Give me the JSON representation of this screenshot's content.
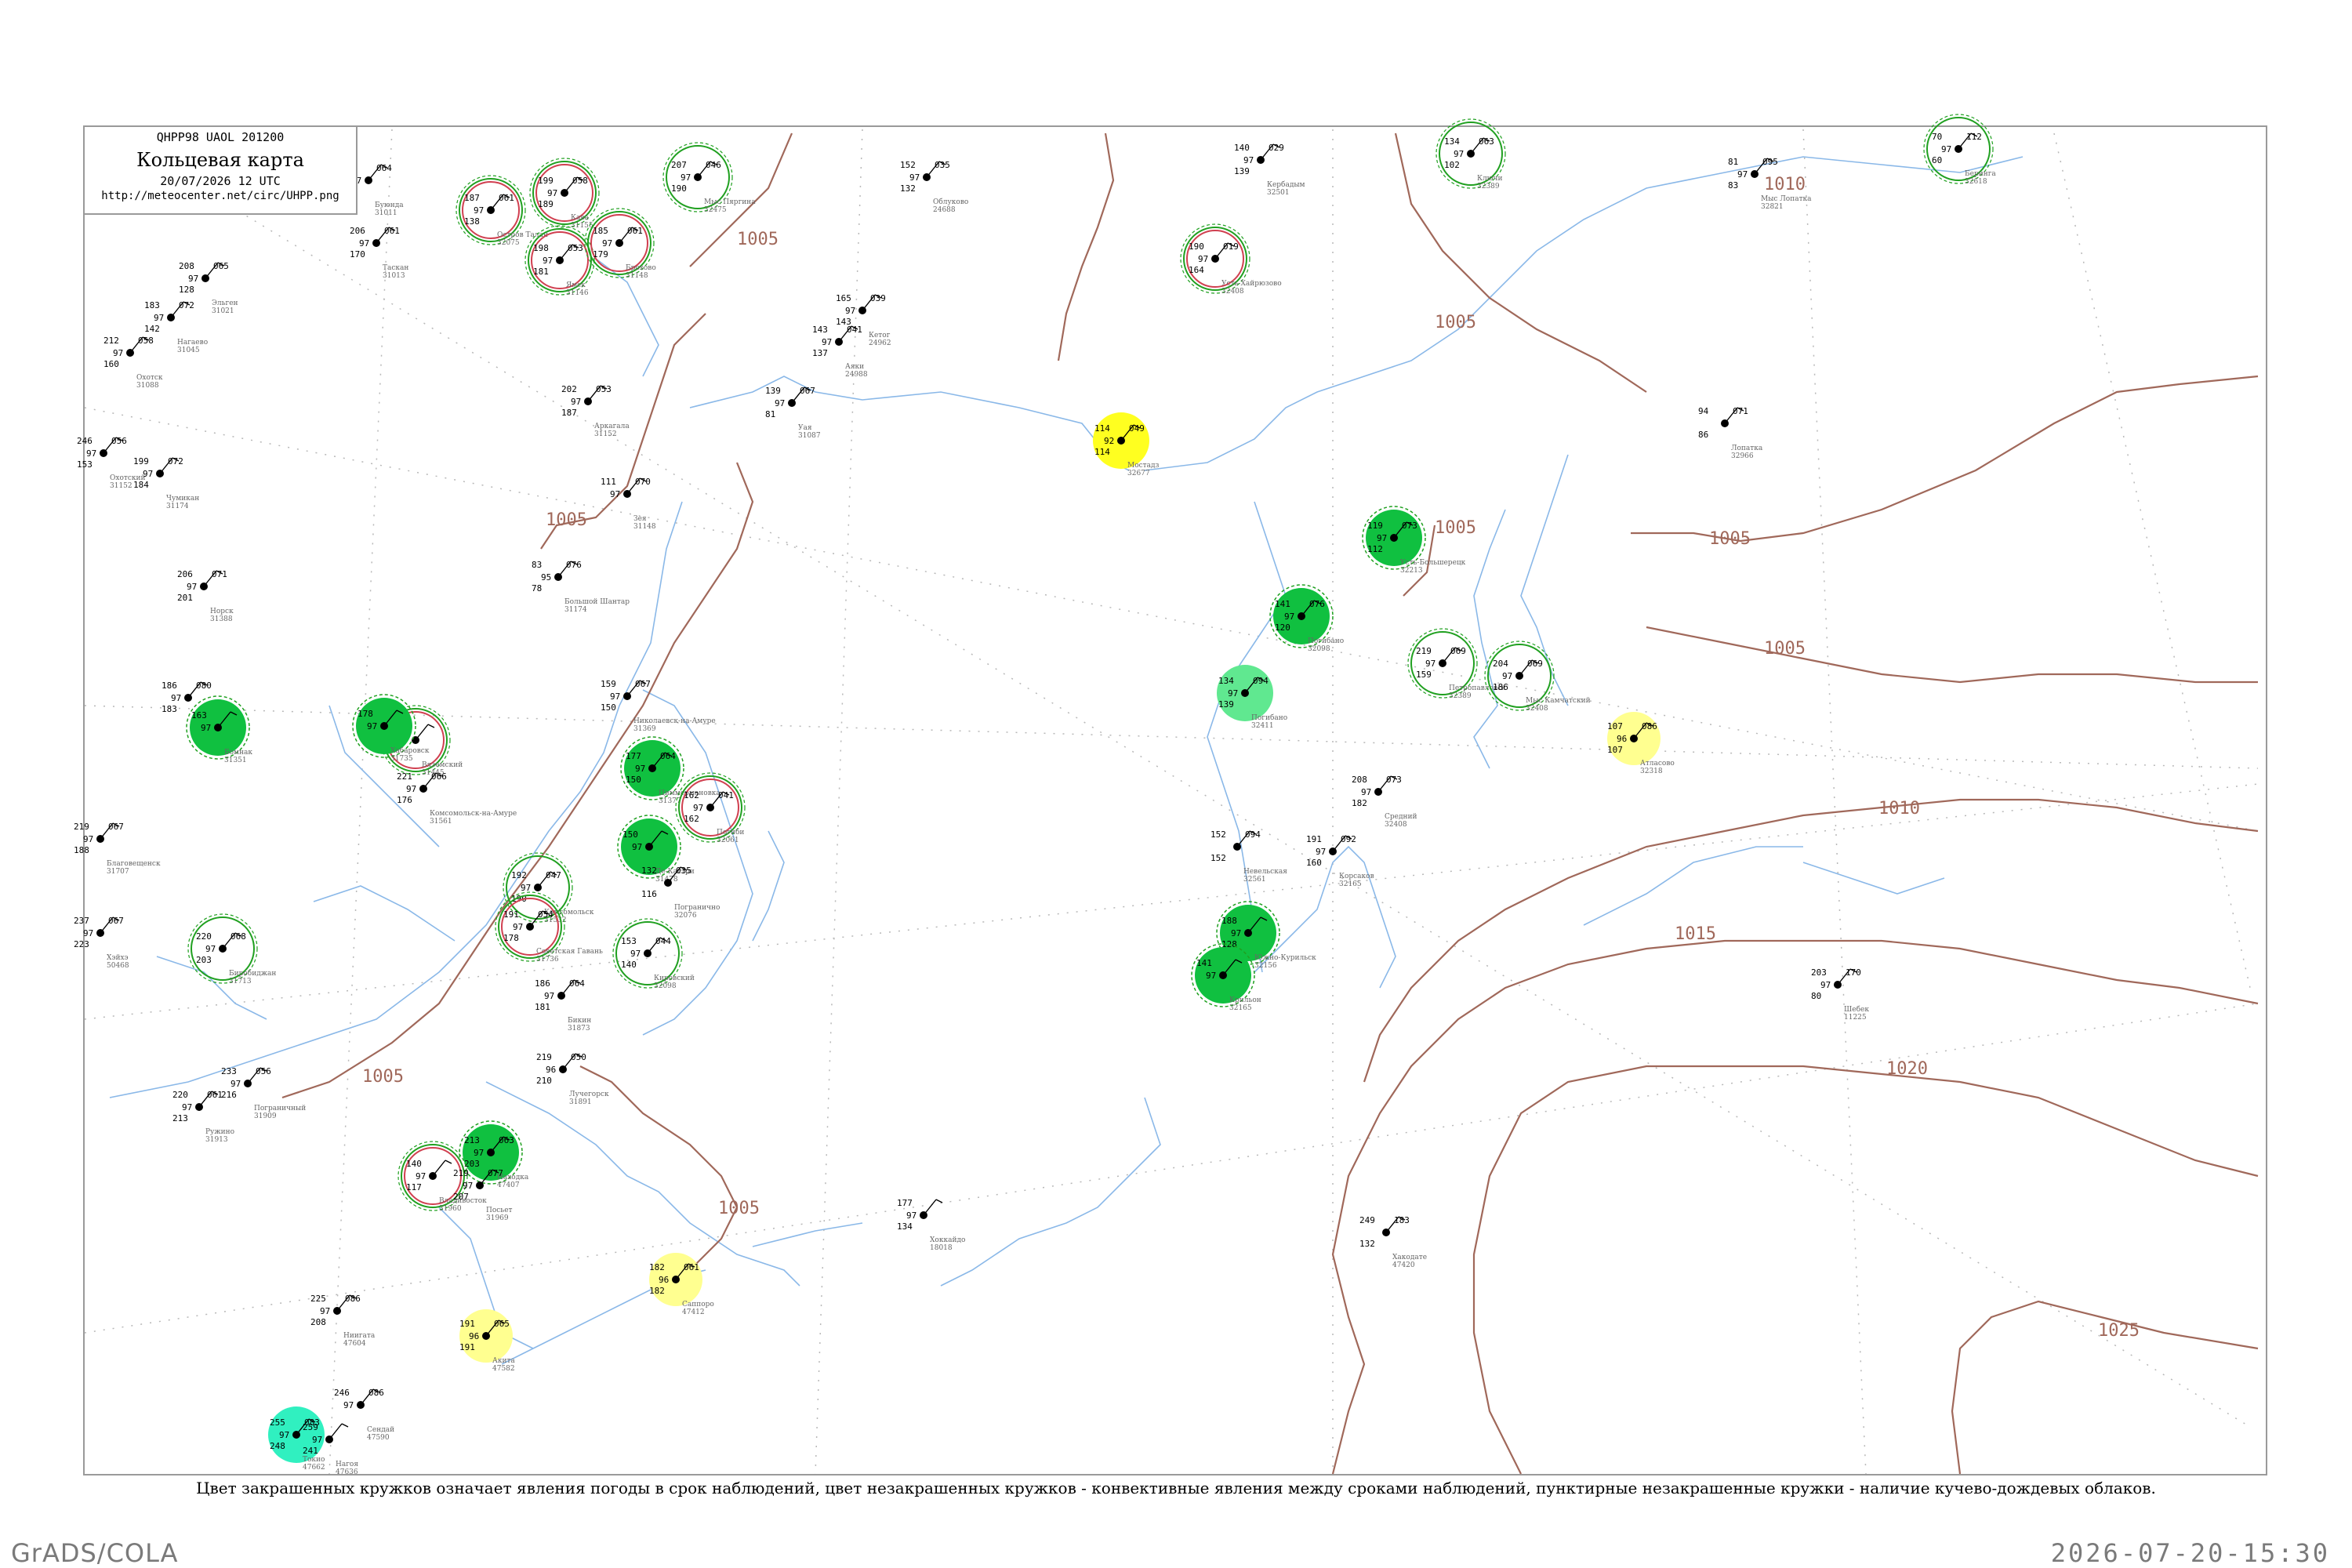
{
  "header": {
    "code_line": "QHPP98  UAOL  201200",
    "title": "Кольцевая карта",
    "datetime": "20/07/2026 12 UTC",
    "url": "http://meteocenter.net/circ/UHPP.png"
  },
  "caption": "Цвет закрашенных кружков означает явления погоды в срок наблюдений, цвет незакрашенных кружков - конвективные явления между сроками наблюдений, пунктирные незакрашенные кружки - наличие кучево-дождевых облаков.",
  "footer": {
    "software": "GrADS/COLA",
    "timestamp": "2026-07-20-15:30"
  },
  "colors": {
    "isobar": "#a0685a",
    "coast": "#8ab8e8",
    "frame": "#9a9a9a",
    "rain_fill": "#10c040",
    "shower_fill": "#60e890",
    "fog_fill": "#ffff20",
    "haze_fill": "#ffff90",
    "drizzle_fill": "#30f0c0",
    "thunder_ring": "#20a020",
    "cb_ring": "#d04050"
  },
  "isobar_labels": [
    {
      "id": "iso-1005-a",
      "value": "1005"
    },
    {
      "id": "iso-1005-b",
      "value": "1005"
    },
    {
      "id": "iso-1005-c",
      "value": "1005"
    },
    {
      "id": "iso-1005-d",
      "value": "1005"
    },
    {
      "id": "iso-1005-e",
      "value": "1005"
    },
    {
      "id": "iso-1005-f",
      "value": "1005"
    },
    {
      "id": "iso-1005-g",
      "value": "1005"
    },
    {
      "id": "iso-1005-h",
      "value": "1005"
    },
    {
      "id": "iso-1010-a",
      "value": "1010"
    },
    {
      "id": "iso-1010-b",
      "value": "1010"
    },
    {
      "id": "iso-1015",
      "value": "1015"
    },
    {
      "id": "iso-1020",
      "value": "1020"
    },
    {
      "id": "iso-1025",
      "value": "1025"
    }
  ],
  "stations": [
    {
      "id": "s1",
      "p": "224",
      "t": "064",
      "v": "97",
      "s": "186",
      "name": "Буюнда",
      "idx": "31011",
      "kind": "plain"
    },
    {
      "id": "s2",
      "p": "206",
      "t": "061",
      "v": "97",
      "s": "170",
      "name": "Таскан",
      "idx": "31013",
      "kind": "plain"
    },
    {
      "id": "s3",
      "p": "208",
      "t": "065",
      "v": "97",
      "s": "128",
      "name": "Эльген",
      "idx": "31021",
      "kind": "plain"
    },
    {
      "id": "s4",
      "p": "183",
      "t": "072",
      "v": "97",
      "s": "142",
      "name": "Нагаево",
      "idx": "31045",
      "kind": "plain"
    },
    {
      "id": "s5",
      "p": "212",
      "t": "058",
      "v": "97",
      "s": "160",
      "name": "Охотск",
      "idx": "31088",
      "kind": "plain"
    },
    {
      "id": "s6",
      "p": "187",
      "t": "061",
      "v": "97",
      "s": "138",
      "name": "Остров Талан",
      "idx": "32075",
      "kind": "thunder_cb"
    },
    {
      "id": "s7",
      "p": "199",
      "t": "058",
      "v": "97",
      "s": "189",
      "name": "Кава",
      "idx": "31155",
      "kind": "thunder_cb"
    },
    {
      "id": "s8",
      "p": "198",
      "t": "053",
      "v": "97",
      "s": "181",
      "name": "Ямск",
      "idx": "31146",
      "kind": "thunder_cb"
    },
    {
      "id": "s9",
      "p": "185",
      "t": "061",
      "v": "97",
      "s": "179",
      "name": "Брохово",
      "idx": "31148",
      "kind": "thunder_cb"
    },
    {
      "id": "s10",
      "p": "207",
      "t": "046",
      "v": "97",
      "s": "190",
      "name": "Мыс Пяргина",
      "idx": "32475",
      "kind": "thunder"
    },
    {
      "id": "s11",
      "p": "152",
      "t": "035",
      "v": "97",
      "s": "132",
      "name": "Облуково",
      "idx": "24688",
      "kind": "plain"
    },
    {
      "id": "s12",
      "p": "140",
      "t": "029",
      "v": "97",
      "s": "139",
      "name": "Кербадым",
      "idx": "32501",
      "kind": "plain"
    },
    {
      "id": "s13",
      "p": "134",
      "t": "063",
      "v": "97",
      "s": "102",
      "name": "Ключи",
      "idx": "32389",
      "kind": "thunder"
    },
    {
      "id": "s14",
      "p": "70",
      "t": "112",
      "v": "97",
      "s": "60",
      "name": "Беринга",
      "idx": "32618",
      "kind": "thunder"
    },
    {
      "id": "s15",
      "p": "81",
      "t": "095",
      "v": "97",
      "s": "83",
      "name": "Мыс Лопатка",
      "idx": "32821",
      "kind": "plain"
    },
    {
      "id": "s16",
      "p": "190",
      "t": "019",
      "v": "97",
      "s": "164",
      "name": "Усть-Хайрюзово",
      "idx": "32408",
      "kind": "thunder_cb"
    },
    {
      "id": "s17",
      "p": "165",
      "t": "039",
      "v": "97",
      "s": "143",
      "name": "Кетог",
      "idx": "24962",
      "kind": "plain"
    },
    {
      "id": "s18",
      "p": "143",
      "t": "041",
      "v": "97",
      "s": "137",
      "name": "Аяки",
      "idx": "24988",
      "kind": "plain"
    },
    {
      "id": "s19",
      "p": "202",
      "t": "053",
      "v": "97",
      "s": "187",
      "name": "Аркагала",
      "idx": "31152",
      "kind": "plain"
    },
    {
      "id": "s20",
      "p": "139",
      "t": "067",
      "v": "97",
      "s": "81",
      "name": "Уая",
      "idx": "31087",
      "kind": "plain"
    },
    {
      "id": "s21",
      "p": "114",
      "t": "049",
      "v": "92",
      "s": "114",
      "name": "Мостадз",
      "idx": "32677",
      "kind": "fog"
    },
    {
      "id": "s22",
      "p": "94",
      "t": "071",
      "v": "",
      "s": "86",
      "name": "Лопатка",
      "idx": "32966",
      "kind": "plain"
    },
    {
      "id": "s23",
      "p": "111",
      "t": "070",
      "v": "97",
      "s": "",
      "name": "Зея",
      "idx": "31148",
      "kind": "plain"
    },
    {
      "id": "s24",
      "p": "83",
      "t": "076",
      "v": "95",
      "s": "78",
      "name": "Большой Шантар",
      "idx": "31174",
      "kind": "plain"
    },
    {
      "id": "s25",
      "p": "119",
      "t": "073",
      "v": "97",
      "s": "112",
      "name": "Усть-Большерецк",
      "idx": "32213",
      "kind": "rain"
    },
    {
      "id": "s26",
      "p": "141",
      "t": "076",
      "v": "97",
      "s": "120",
      "name": "Погибано",
      "idx": "32098",
      "kind": "rain"
    },
    {
      "id": "s27",
      "p": "219",
      "t": "069",
      "v": "97",
      "s": "159",
      "name": "Петропавловск",
      "idx": "32389",
      "kind": "thunder"
    },
    {
      "id": "s28",
      "p": "204",
      "t": "069",
      "v": "97",
      "s": "186",
      "name": "Мыс Камчатский",
      "idx": "32408",
      "kind": "thunder"
    },
    {
      "id": "s29",
      "p": "134",
      "t": "094",
      "v": "97",
      "s": "139",
      "name": "Погибано",
      "idx": "32411",
      "kind": "shower"
    },
    {
      "id": "s30",
      "p": "107",
      "t": "086",
      "v": "96",
      "s": "107",
      "name": "Атласово",
      "idx": "32318",
      "kind": "haze"
    },
    {
      "id": "s31",
      "p": "208",
      "t": "073",
      "v": "97",
      "s": "182",
      "name": "Средний",
      "idx": "32408",
      "kind": "plain"
    },
    {
      "id": "s32",
      "p": "191",
      "t": "092",
      "v": "97",
      "s": "160",
      "name": "Корсаков",
      "idx": "32165",
      "kind": "plain"
    },
    {
      "id": "s33",
      "p": "152",
      "t": "094",
      "v": "",
      "s": "152",
      "name": "Невельская",
      "idx": "32561",
      "kind": "plain"
    },
    {
      "id": "s34",
      "p": "188",
      "t": "",
      "v": "97",
      "s": "128",
      "name": "Южно-Курильск",
      "idx": "32156",
      "kind": "rain"
    },
    {
      "id": "s35",
      "p": "141",
      "t": "",
      "v": "97",
      "s": "",
      "name": "Крильон",
      "idx": "32165",
      "kind": "rain"
    },
    {
      "id": "s36",
      "p": "203",
      "t": "170",
      "v": "97",
      "s": "80",
      "name": "Шебек",
      "idx": "11225",
      "kind": "plain"
    },
    {
      "id": "s37",
      "p": "177",
      "t": "",
      "v": "97",
      "s": "134",
      "name": "Хоккайдо",
      "idx": "18018",
      "kind": "plain"
    },
    {
      "id": "s38",
      "p": "249",
      "t": "183",
      "v": "",
      "s": "132",
      "name": "Хакодате",
      "idx": "47420",
      "kind": "plain"
    },
    {
      "id": "s39",
      "p": "159",
      "t": "067",
      "v": "97",
      "s": "150",
      "name": "Николаевск-на-Амуре",
      "idx": "31369",
      "kind": "plain"
    },
    {
      "id": "s40",
      "p": "177",
      "t": "064",
      "v": "97",
      "s": "150",
      "name": "Циммермановка",
      "idx": "31377",
      "kind": "rain"
    },
    {
      "id": "s41",
      "p": "162",
      "t": "041",
      "v": "97",
      "s": "162",
      "name": "Погиби",
      "idx": "32061",
      "kind": "thunder_cb"
    },
    {
      "id": "s42",
      "p": "150",
      "t": "",
      "v": "97",
      "s": "",
      "name": "Де-Кастри",
      "idx": "31478",
      "kind": "rain"
    },
    {
      "id": "s43",
      "p": "132",
      "t": "035",
      "v": "",
      "s": "116",
      "name": "Погранично",
      "idx": "32076",
      "kind": "plain"
    },
    {
      "id": "s44",
      "p": "153",
      "t": "044",
      "v": "97",
      "s": "140",
      "name": "Кировский",
      "idx": "32098",
      "kind": "thunder"
    },
    {
      "id": "s45",
      "p": "192",
      "t": "047",
      "v": "97",
      "s": "190",
      "name": "Комсомольск",
      "idx": "31532",
      "kind": "thunder"
    },
    {
      "id": "s46",
      "p": "191",
      "t": "054",
      "v": "97",
      "s": "178",
      "name": "Советская Гавань",
      "idx": "31736",
      "kind": "thunder_cb"
    },
    {
      "id": "s47",
      "p": "221",
      "t": "066",
      "v": "97",
      "s": "176",
      "name": "Комсомольск-на-Амуре",
      "idx": "31561",
      "kind": "plain"
    },
    {
      "id": "s48",
      "p": "183",
      "t": "",
      "v": "97",
      "s": "",
      "name": "Вяземский",
      "idx": "31445",
      "kind": "thunder_cb"
    },
    {
      "id": "s49",
      "p": "178",
      "t": "",
      "v": "97",
      "s": "",
      "name": "Хабаровск",
      "idx": "31735",
      "kind": "rain"
    },
    {
      "id": "s50",
      "p": "186",
      "t": "064",
      "v": "97",
      "s": "181",
      "name": "Бикин",
      "idx": "31873",
      "kind": "plain"
    },
    {
      "id": "s51",
      "p": "219",
      "t": "050",
      "v": "96",
      "s": "210",
      "name": "Лучегорск",
      "idx": "31891",
      "kind": "plain"
    },
    {
      "id": "s52",
      "p": "220",
      "t": "068",
      "v": "97",
      "s": "203",
      "name": "Биробиджан",
      "idx": "31713",
      "kind": "thunder"
    },
    {
      "id": "s53",
      "p": "233",
      "t": "056",
      "v": "97",
      "s": "216",
      "name": "Пограничный",
      "idx": "31909",
      "kind": "plain"
    },
    {
      "id": "s54",
      "p": "220",
      "t": "061",
      "v": "97",
      "s": "213",
      "name": "Ружино",
      "idx": "31913",
      "kind": "plain"
    },
    {
      "id": "s55",
      "p": "213",
      "t": "063",
      "v": "97",
      "s": "203",
      "name": "Находка",
      "idx": "47407",
      "kind": "rain"
    },
    {
      "id": "s56",
      "p": "140",
      "t": "",
      "v": "97",
      "s": "117",
      "name": "Владивосток",
      "idx": "31960",
      "kind": "thunder_cb"
    },
    {
      "id": "s57",
      "p": "219",
      "t": "077",
      "v": "97",
      "s": "207",
      "name": "Посьет",
      "idx": "31969",
      "kind": "plain"
    },
    {
      "id": "s58",
      "p": "182",
      "t": "061",
      "v": "96",
      "s": "182",
      "name": "Саппоро",
      "idx": "47412",
      "kind": "haze"
    },
    {
      "id": "s59",
      "p": "191",
      "t": "065",
      "v": "96",
      "s": "191",
      "name": "Акита",
      "idx": "47582",
      "kind": "haze"
    },
    {
      "id": "s60",
      "p": "255",
      "t": "083",
      "v": "97",
      "s": "248",
      "name": "Токио",
      "idx": "47662",
      "kind": "drizzle"
    },
    {
      "id": "s61",
      "p": "225",
      "t": "086",
      "v": "97",
      "s": "208",
      "name": "Ниигата",
      "idx": "47604",
      "kind": "plain"
    },
    {
      "id": "s62",
      "p": "246",
      "t": "086",
      "v": "97",
      "s": "",
      "name": "Сендай",
      "idx": "47590",
      "kind": "plain"
    },
    {
      "id": "s63",
      "p": "259",
      "t": "",
      "v": "97",
      "s": "241",
      "name": "Нагоя",
      "idx": "47636",
      "kind": "plain"
    },
    {
      "id": "s64",
      "p": "246",
      "t": "056",
      "v": "97",
      "s": "153",
      "name": "Охотский",
      "idx": "31152",
      "kind": "plain"
    },
    {
      "id": "s65",
      "p": "199",
      "t": "072",
      "v": "97",
      "s": "184",
      "name": "Чумикан",
      "idx": "31174",
      "kind": "plain"
    },
    {
      "id": "s66",
      "p": "206",
      "t": "071",
      "v": "97",
      "s": "201",
      "name": "Норск",
      "idx": "31388",
      "kind": "plain"
    },
    {
      "id": "s67",
      "p": "186",
      "t": "080",
      "v": "97",
      "s": "183",
      "name": "Экимчан",
      "idx": "31416",
      "kind": "plain"
    },
    {
      "id": "s68",
      "p": "163",
      "t": "",
      "v": "97",
      "s": "",
      "name": "Бомнак",
      "idx": "31351",
      "kind": "rain"
    },
    {
      "id": "s69",
      "p": "219",
      "t": "067",
      "v": "97",
      "s": "188",
      "name": "Благовещенск",
      "idx": "31707",
      "kind": "plain"
    },
    {
      "id": "s70",
      "p": "237",
      "t": "067",
      "v": "97",
      "s": "223",
      "name": "Хэйхэ",
      "idx": "50468",
      "kind": "plain"
    }
  ]
}
